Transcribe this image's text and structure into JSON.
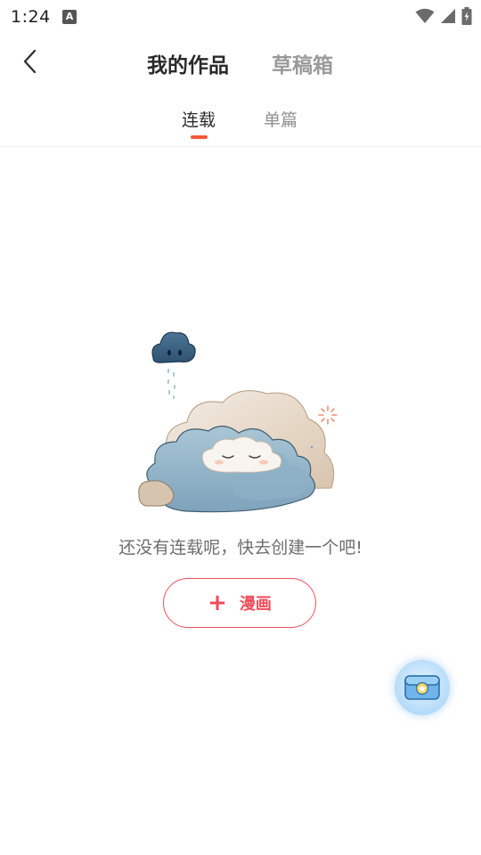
{
  "status_bar": {
    "time": "1:24",
    "notification_badge": "A",
    "icons": [
      "wifi-icon",
      "cell-signal-icon",
      "battery-icon"
    ]
  },
  "header": {
    "tabs": [
      {
        "label": "我的作品",
        "active": true
      },
      {
        "label": "草稿箱",
        "active": false
      }
    ]
  },
  "sub_tabs": [
    {
      "label": "连载",
      "active": true
    },
    {
      "label": "单篇",
      "active": false
    }
  ],
  "empty_state": {
    "message": "还没有连载呢，快去创建一个吧!",
    "create_button": {
      "icon": "+",
      "label": "漫画"
    }
  },
  "floating_button": {
    "icon": "treasure-chest-icon"
  },
  "colors": {
    "accent": "#f0573b",
    "button": "#f04b5a",
    "text_primary": "#2a2a2a",
    "text_secondary": "#9a9a9a"
  }
}
